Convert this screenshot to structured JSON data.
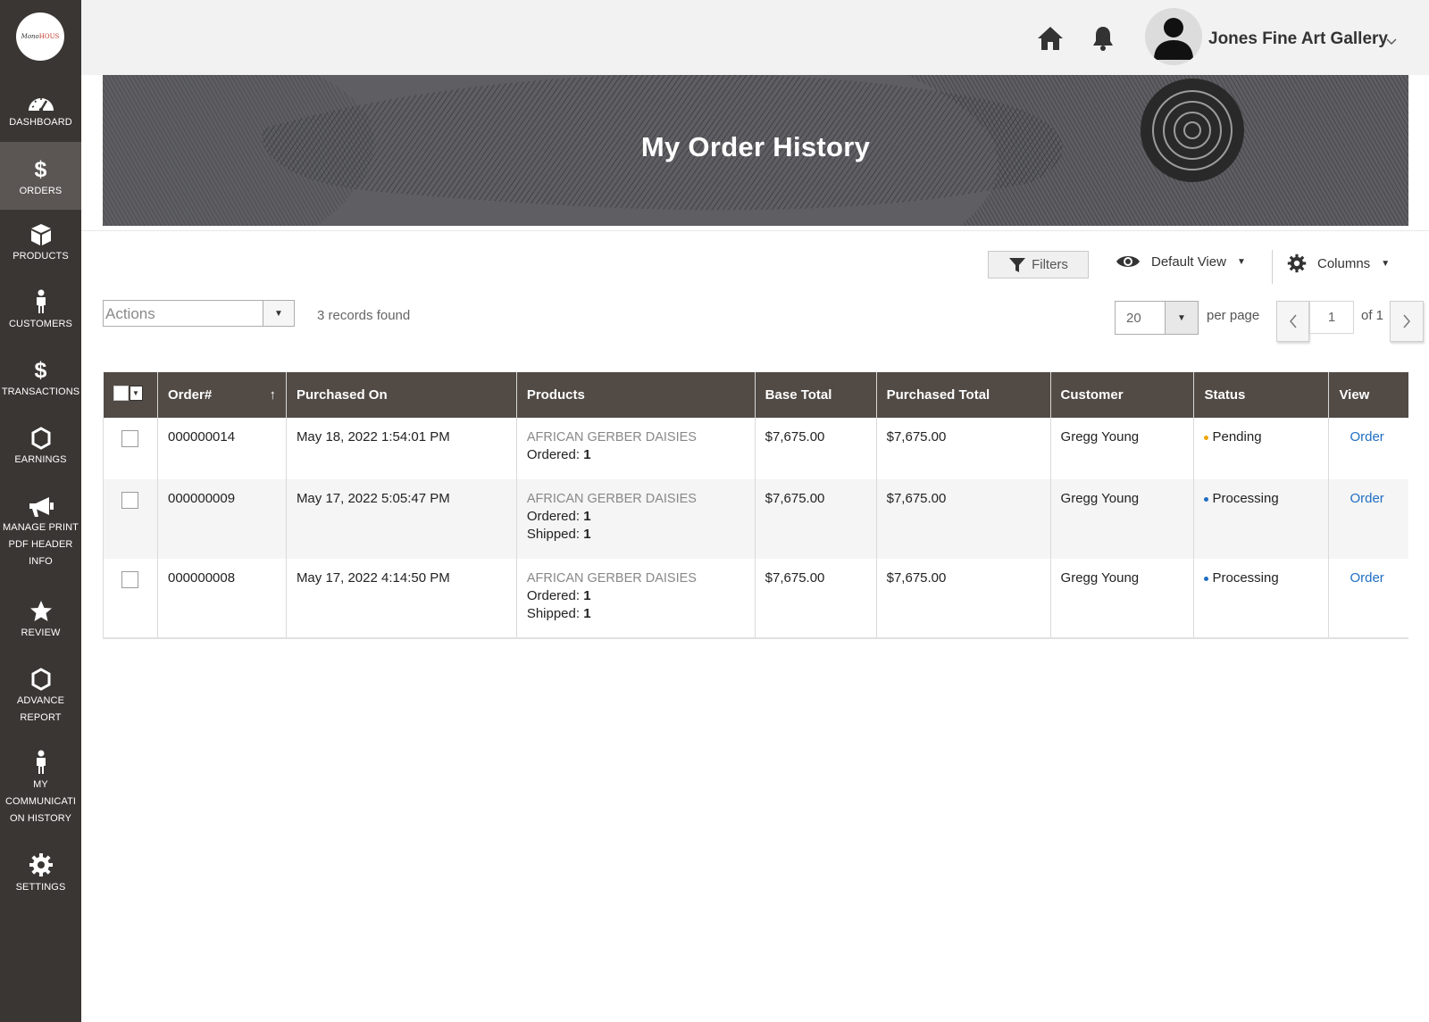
{
  "brand": {
    "logo_a": "Mono",
    "logo_b": "HOUS"
  },
  "sidebar": {
    "items": [
      {
        "label": "DASHBOARD"
      },
      {
        "label": "ORDERS"
      },
      {
        "label": "PRODUCTS"
      },
      {
        "label": "CUSTOMERS"
      },
      {
        "label": "TRANSACTIONS"
      },
      {
        "label": "EARNINGS"
      },
      {
        "label": "MANAGE PRINT\nPDF HEADER\nINFO"
      },
      {
        "label": "REVIEW"
      },
      {
        "label": "ADVANCE\nREPORT"
      },
      {
        "label": "MY\nCOMMUNICATI\nON HISTORY"
      },
      {
        "label": "SETTINGS"
      }
    ],
    "dollar_glyph": "$"
  },
  "header": {
    "user_name": "Jones Fine Art Gallery"
  },
  "banner": {
    "title": "My Order History"
  },
  "toolbar": {
    "filters_label": "Filters",
    "view_label": "Default View",
    "columns_label": "Columns",
    "actions_placeholder": "Actions",
    "records_found": "3 records found",
    "per_page_value": "20",
    "per_page_label": "per page",
    "current_page": "1",
    "page_of": "of 1"
  },
  "table": {
    "columns": [
      "Order#",
      "Purchased On",
      "Products",
      "Base Total",
      "Purchased Total",
      "Customer",
      "Status",
      "View"
    ],
    "rows": [
      {
        "order": "000000014",
        "purchased_on": "May 18, 2022 1:54:01 PM",
        "product": "AFRICAN GERBER DAISIES",
        "ordered_label": "Ordered:",
        "ordered_qty": "1",
        "base_total": "$7,675.00",
        "purchased_total": "$7,675.00",
        "customer": "Gregg Young",
        "status": "Pending",
        "view": "Order"
      },
      {
        "order": "000000009",
        "purchased_on": "May 17, 2022 5:05:47 PM",
        "product": "AFRICAN GERBER DAISIES",
        "ordered_label": "Ordered:",
        "ordered_qty": "1",
        "shipped_label": "Shipped:",
        "shipped_qty": "1",
        "base_total": "$7,675.00",
        "purchased_total": "$7,675.00",
        "customer": "Gregg Young",
        "status": "Processing",
        "view": "Order"
      },
      {
        "order": "000000008",
        "purchased_on": "May 17, 2022 4:14:50 PM",
        "product": "AFRICAN GERBER DAISIES",
        "ordered_label": "Ordered:",
        "ordered_qty": "1",
        "shipped_label": "Shipped:",
        "shipped_qty": "1",
        "base_total": "$7,675.00",
        "purchased_total": "$7,675.00",
        "customer": "Gregg Young",
        "status": "Processing",
        "view": "Order"
      }
    ]
  },
  "colors": {
    "sidebar_bg": "#3a3633",
    "sidebar_active": "#5b5654",
    "table_header": "#514a45",
    "status_pending": "#f0a500",
    "status_processing": "#1f6ec3",
    "link": "#1f6ec3"
  },
  "icons": {
    "sidebar": [
      "dashboard-icon",
      "dollar-icon",
      "box-icon",
      "person-icon",
      "dollar-icon",
      "hexagon-icon",
      "megaphone-icon",
      "star-icon",
      "hexagon-icon",
      "person-icon",
      "gear-icon"
    ],
    "header": [
      "home-icon",
      "bell-icon",
      "user-avatar-icon",
      "chevron-down-icon"
    ],
    "toolbar": [
      "funnel-icon",
      "eye-icon",
      "gear-icon",
      "caret-down-icon",
      "chevron-left-icon",
      "chevron-right-icon"
    ]
  }
}
